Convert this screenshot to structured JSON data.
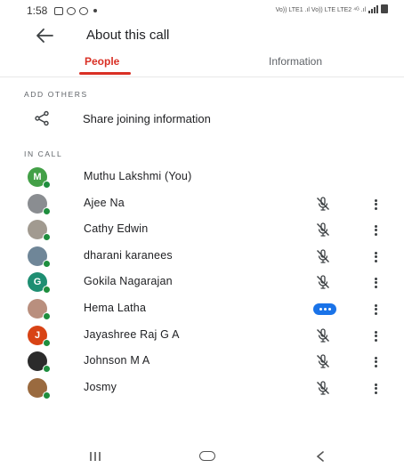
{
  "status_bar": {
    "time": "1:58",
    "network_text": "Vo)) LTE1 .ıl Vo)) LTE LTE2 ⁴ᴳ .ıl"
  },
  "header": {
    "title": "About this call"
  },
  "tabs": [
    {
      "label": "People",
      "selected": true
    },
    {
      "label": "Information",
      "selected": false
    }
  ],
  "sections": {
    "add_others": "ADD OTHERS",
    "in_call": "IN CALL"
  },
  "share": {
    "label": "Share joining information",
    "icon": "share-icon"
  },
  "participants": [
    {
      "name": "Muthu Lakshmi (You)",
      "initial": "M",
      "avatar_color": "#43a047",
      "mic": "none"
    },
    {
      "name": "Ajee Na",
      "initial": "",
      "avatar_color": "#8a8d91",
      "mic": "muted"
    },
    {
      "name": "Cathy Edwin",
      "initial": "",
      "avatar_color": "#a19a90",
      "mic": "muted"
    },
    {
      "name": "dharani karanees",
      "initial": "",
      "avatar_color": "#6f8698",
      "mic": "muted"
    },
    {
      "name": "Gokila Nagarajan",
      "initial": "G",
      "avatar_color": "#1e8e72",
      "mic": "muted"
    },
    {
      "name": "Hema Latha",
      "initial": "",
      "avatar_color": "#b98f7e",
      "mic": "speaking"
    },
    {
      "name": "Jayashree Raj G A",
      "initial": "J",
      "avatar_color": "#d84315",
      "mic": "muted"
    },
    {
      "name": "Johnson M A",
      "initial": "",
      "avatar_color": "#2b2b2b",
      "mic": "muted"
    },
    {
      "name": "Josmy",
      "initial": "",
      "avatar_color": "#9a6a3f",
      "mic": "muted"
    }
  ],
  "colors": {
    "accent": "#d93025",
    "presence": "#1e8e3e",
    "speaking": "#1a73e8"
  }
}
